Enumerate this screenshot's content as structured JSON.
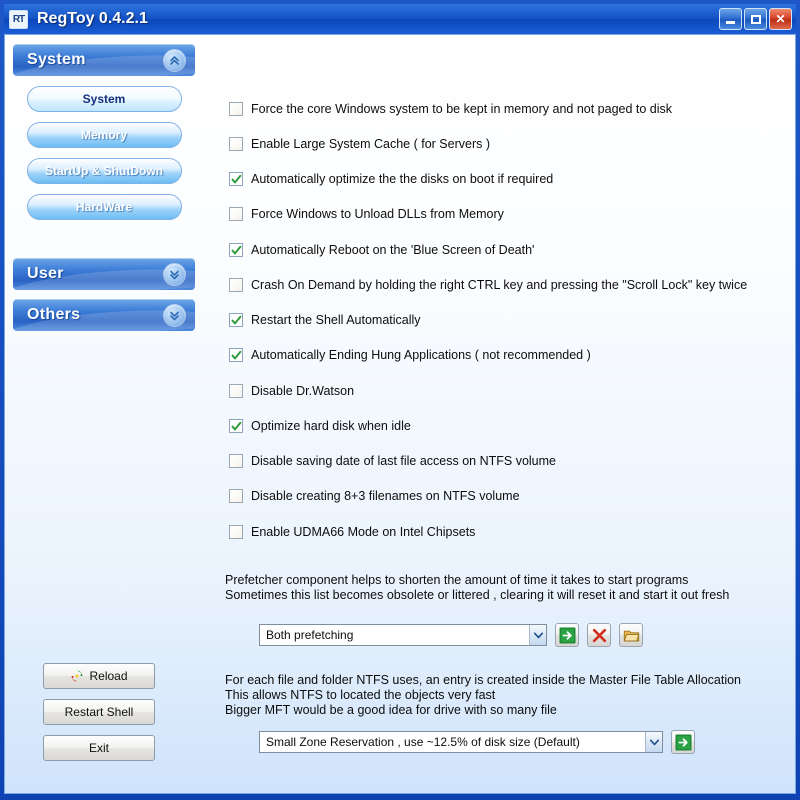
{
  "window": {
    "title": "RegToy 0.4.2.1",
    "app_icon": "RT",
    "minimize_label": "Minimize",
    "maximize_label": "Maximize",
    "close_label": "Close"
  },
  "sidebar": {
    "groups": [
      {
        "label": "System",
        "expanded": true,
        "chevron": "chevron-up-double-icon"
      },
      {
        "label": "User",
        "expanded": false,
        "chevron": "chevron-down-double-icon"
      },
      {
        "label": "Others",
        "expanded": false,
        "chevron": "chevron-down-double-icon"
      }
    ],
    "system_items": [
      {
        "label": "System",
        "active": true
      },
      {
        "label": "Memory",
        "active": false
      },
      {
        "label": "StartUp & ShutDown",
        "active": false
      },
      {
        "label": "HardWare",
        "active": false
      }
    ]
  },
  "bottom_buttons": [
    {
      "label": "Reload",
      "icon": "refresh-icon"
    },
    {
      "label": "Restart Shell",
      "icon": ""
    },
    {
      "label": "Exit",
      "icon": ""
    }
  ],
  "main": {
    "checkboxes": [
      {
        "label": "Force the core Windows system to be kept in memory and not paged to disk",
        "checked": false
      },
      {
        "label": "Enable Large System Cache ( for Servers )",
        "checked": false
      },
      {
        "label": "Automatically optimize the the disks on boot if required",
        "checked": true
      },
      {
        "label": "Force Windows to Unload DLLs from Memory",
        "checked": false
      },
      {
        "label": "Automatically Reboot on the 'Blue Screen of Death'",
        "checked": true
      },
      {
        "label": "Crash On Demand by holding the right CTRL key and pressing the \"Scroll Lock\" key twice",
        "checked": false
      },
      {
        "label": "Restart the Shell Automatically",
        "checked": true
      },
      {
        "label": "Automatically Ending Hung Applications ( not recommended )",
        "checked": true
      },
      {
        "label": "Disable Dr.Watson",
        "checked": false
      },
      {
        "label": "Optimize hard disk when idle",
        "checked": true
      },
      {
        "label": "Disable saving date of last file access on NTFS volume",
        "checked": false
      },
      {
        "label": "Disable creating 8+3 filenames on NTFS volume",
        "checked": false
      },
      {
        "label": "Enable UDMA66 Mode on Intel Chipsets",
        "checked": false
      }
    ],
    "prefetch": {
      "description": "Prefetcher component helps to shorten the amount of time it takes to start programs\nSometimes this list becomes obsolete or littered , clearing it will reset it and start it out fresh",
      "selected": "Both prefetching",
      "apply_icon": "arrow-right-green-icon",
      "clear_icon": "close-red-x-icon",
      "browse_icon": "folder-open-icon"
    },
    "mft": {
      "description": "For each file and folder NTFS uses, an entry is created inside the Master File Table Allocation\nThis allows NTFS to located the objects very fast\nBigger MFT would be a good idea for drive with so many file",
      "selected": "Small Zone Reservation , use ~12.5% of disk size (Default)",
      "apply_icon": "arrow-right-green-icon"
    }
  }
}
